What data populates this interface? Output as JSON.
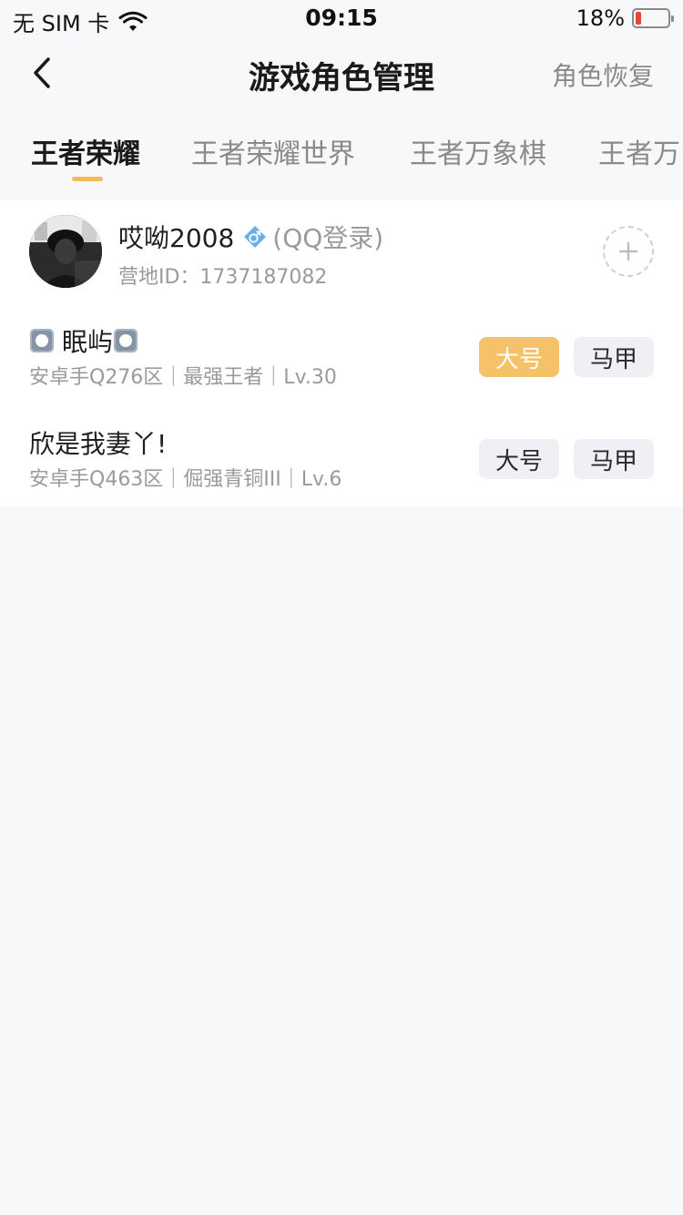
{
  "status_bar": {
    "carrier": "无 SIM 卡",
    "time": "09:15",
    "battery_percent_text": "18%",
    "battery_level": 0.18
  },
  "nav": {
    "title": "游戏角色管理",
    "action_label": "角色恢复"
  },
  "tabs": [
    {
      "label": "王者荣耀",
      "active": true
    },
    {
      "label": "王者荣耀世界",
      "active": false
    },
    {
      "label": "王者万象棋",
      "active": false
    },
    {
      "label": "王者万",
      "active": false
    }
  ],
  "account": {
    "name": "哎呦2008",
    "login_type": "(QQ登录)",
    "camp_id": "营地ID：1737187082",
    "gender_icon": "male-icon"
  },
  "roles": [
    {
      "name": "眠屿",
      "meta": "安卓手Q276区｜最强王者｜Lv.30",
      "main_label": "大号",
      "alt_label": "马甲",
      "is_main": true
    },
    {
      "name": "欣是我妻丫!",
      "meta": "安卓手Q463区｜倔强青铜III｜Lv.6",
      "main_label": "大号",
      "alt_label": "马甲",
      "is_main": false
    }
  ],
  "colors": {
    "accent": "#f5b95a",
    "tag_active": "#f5c26a",
    "battery_low": "#e5453b",
    "gender_male": "#4a9be0"
  }
}
